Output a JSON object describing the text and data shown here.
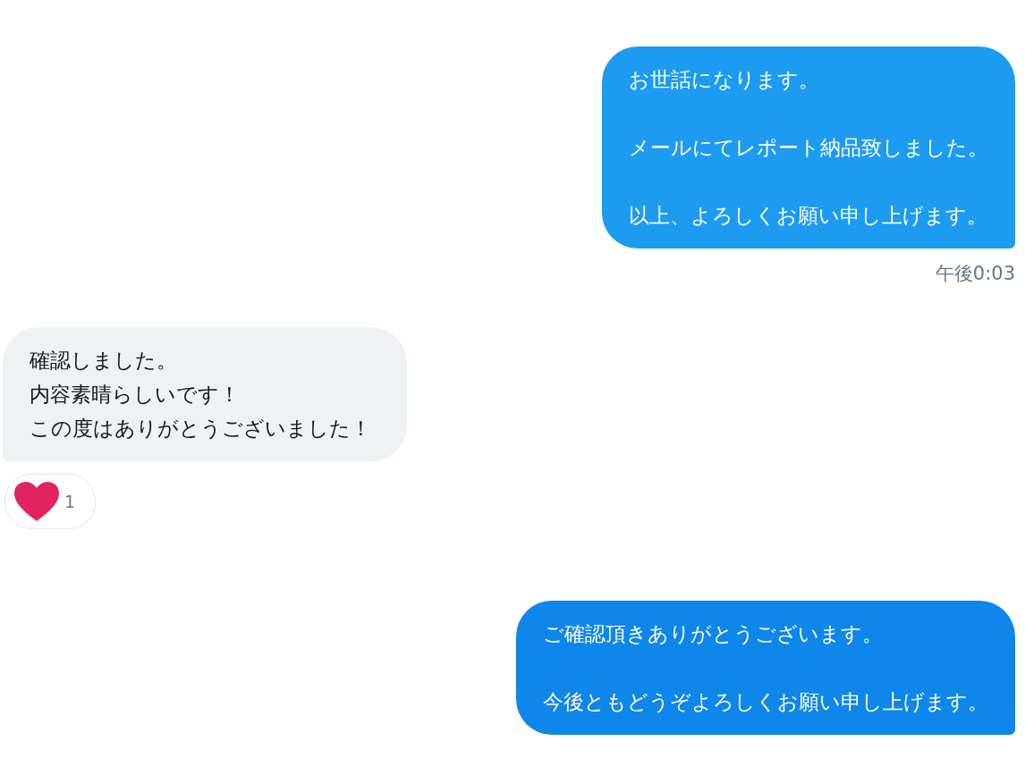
{
  "messages": [
    {
      "kind": "sent",
      "paragraphs": [
        "お世話になります。",
        "メールにてレポート納品致しました。",
        "以上、よろしくお願い申し上げます。"
      ],
      "time": "午後0:03"
    },
    {
      "kind": "received",
      "paragraphs": [
        "確認しました。",
        "内容素晴らしいです！",
        "この度はありがとうございました！"
      ],
      "reaction": {
        "kind": "heart",
        "count": "1"
      }
    },
    {
      "kind": "sent",
      "paragraphs": [
        "ご確認頂きありがとうございます。",
        "今後ともどうぞよろしくお願い申し上げます。"
      ]
    }
  ]
}
